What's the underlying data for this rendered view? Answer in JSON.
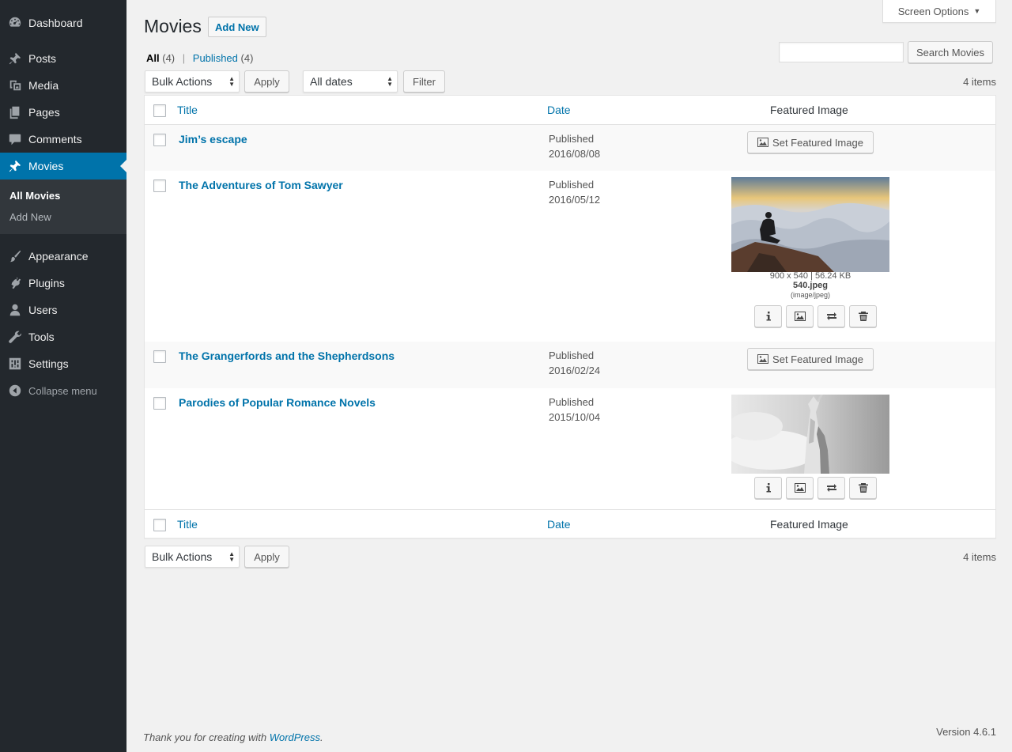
{
  "sidebar": {
    "items": [
      {
        "label": "Dashboard",
        "icon": "dashboard-icon"
      },
      {
        "label": "Posts",
        "icon": "pin-icon"
      },
      {
        "label": "Media",
        "icon": "media-icon"
      },
      {
        "label": "Pages",
        "icon": "pages-icon"
      },
      {
        "label": "Comments",
        "icon": "comments-icon"
      },
      {
        "label": "Movies",
        "icon": "pin-icon"
      },
      {
        "label": "Appearance",
        "icon": "brush-icon"
      },
      {
        "label": "Plugins",
        "icon": "plugin-icon"
      },
      {
        "label": "Users",
        "icon": "users-icon"
      },
      {
        "label": "Tools",
        "icon": "wrench-icon"
      },
      {
        "label": "Settings",
        "icon": "settings-icon"
      }
    ],
    "submenu": [
      "All Movies",
      "Add New"
    ],
    "collapse_label": "Collapse menu"
  },
  "screen_options": {
    "label": "Screen Options",
    "arrow": "▼"
  },
  "page": {
    "title": "Movies",
    "add_new": "Add New"
  },
  "views": {
    "all_label": "All",
    "all_count": "(4)",
    "separator": "|",
    "published_label": "Published",
    "published_count": "(4)"
  },
  "search": {
    "button": "Search Movies",
    "value": ""
  },
  "tablenav_top": {
    "bulk": "Bulk Actions",
    "apply": "Apply",
    "dates": "All dates",
    "filter": "Filter",
    "items": "4 items"
  },
  "tablenav_bottom": {
    "bulk": "Bulk Actions",
    "apply": "Apply",
    "items": "4 items"
  },
  "columns": {
    "title": "Title",
    "date": "Date",
    "featured": "Featured Image"
  },
  "rows": [
    {
      "title": "Jim’s escape",
      "status": "Published",
      "date": "2016/08/08",
      "set_label": "Set Featured Image"
    },
    {
      "title": "The Adventures of Tom Sawyer",
      "status": "Published",
      "date": "2016/05/12",
      "image_dims": "900 x 540 | 56.24 KB",
      "image_name": "540.jpeg",
      "image_type": "(image/jpeg)"
    },
    {
      "title": "The Grangerfords and the Shepherdsons",
      "status": "Published",
      "date": "2016/02/24",
      "set_label": "Set Featured Image"
    },
    {
      "title": "Parodies of Popular Romance Novels",
      "status": "Published",
      "date": "2015/10/04"
    }
  ],
  "footer": {
    "thanks": "Thank you for creating with",
    "link": "WordPress",
    "period": ".",
    "version": "Version 4.6.1"
  },
  "colors": {
    "sidebar_bg": "#23282d",
    "accent": "#0073aa",
    "page_bg": "#f1f1f1"
  }
}
